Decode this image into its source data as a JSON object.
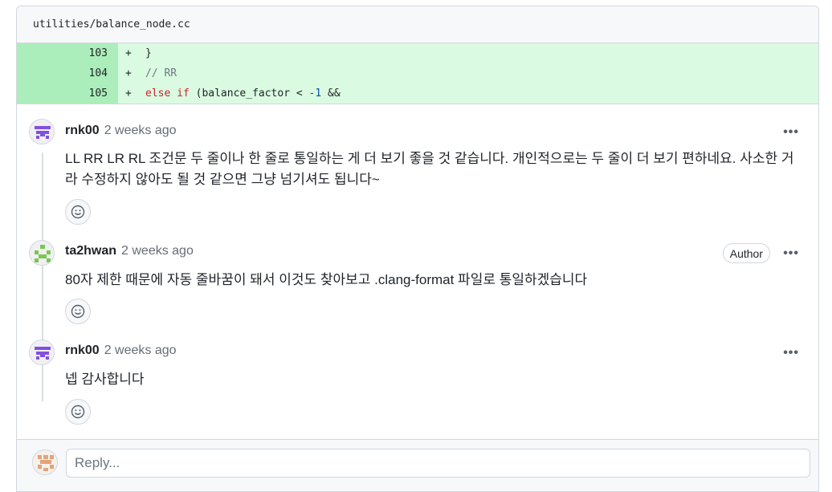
{
  "file": {
    "path": "utilities/balance_node.cc"
  },
  "diff_lines": [
    {
      "number": "103",
      "marker": "+",
      "code": "}"
    },
    {
      "number": "104",
      "marker": "+",
      "code": "// RR"
    },
    {
      "number": "105",
      "marker": "+",
      "code_keyword": "else if",
      "code_text": " (balance_factor < ",
      "code_number": "-1",
      "code_end": " &&"
    }
  ],
  "comments": [
    {
      "author": "rnk00",
      "time": "2 weeks ago",
      "body": "LL RR LR RL 조건문 두 줄이나 한 줄로 통일하는 게 더 보기 좋을 것 같습니다. 개인적으로는 두 줄이 더 보기 편하네요. 사소한 거라 수정하지 않아도 될 것 같으면 그냥 넘기셔도 됩니다~",
      "avatar_icon": "identicon-purple-icon"
    },
    {
      "author": "ta2hwan",
      "time": "2 weeks ago",
      "badge": "Author",
      "body": "80자 제한 때문에 자동 줄바꿈이 돼서 이것도 찾아보고 .clang-format 파일로 통일하겠습니다",
      "avatar_icon": "identicon-green-icon"
    },
    {
      "author": "rnk00",
      "time": "2 weeks ago",
      "body": "넵 감사합니다",
      "avatar_icon": "identicon-purple-icon"
    }
  ],
  "more_label": "•••",
  "reply": {
    "placeholder": "Reply..."
  },
  "colors": {
    "added_line_number_bg": "#aceebb",
    "added_code_bg": "#dafbe1",
    "keyword": "#cf222e",
    "comment": "#6e7781",
    "number": "#0550ae",
    "purple_avatar": "#8250df",
    "green_avatar": "#7ac74f",
    "orange_avatar": "#e0a47a"
  }
}
